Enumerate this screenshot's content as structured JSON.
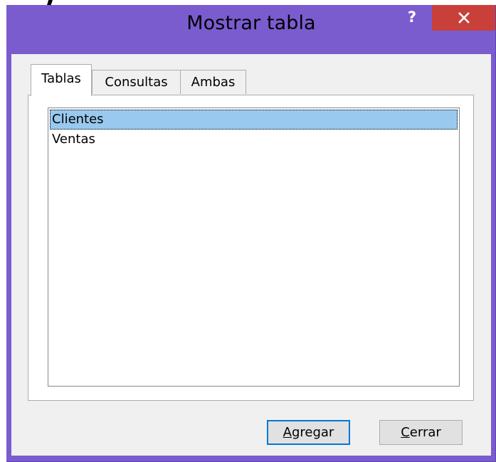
{
  "stray_glyph": ")",
  "window": {
    "title": "Mostrar tabla",
    "help_glyph": "?",
    "close_icon": "close-icon"
  },
  "tabs": [
    {
      "label": "Tablas",
      "active": true
    },
    {
      "label": "Consultas",
      "active": false
    },
    {
      "label": "Ambas",
      "active": false
    }
  ],
  "table_list": {
    "items": [
      {
        "label": "Clientes",
        "selected": true
      },
      {
        "label": "Ventas",
        "selected": false
      }
    ]
  },
  "buttons": {
    "add": {
      "accel": "A",
      "rest": "gregar"
    },
    "close": {
      "accel": "C",
      "rest": "errar"
    }
  },
  "colors": {
    "titlebar": "#7a5ccf",
    "close_button": "#c9403b",
    "selection": "#99c9ef",
    "dialog_background": "#f0f0f0",
    "default_button_border": "#0078d7"
  }
}
